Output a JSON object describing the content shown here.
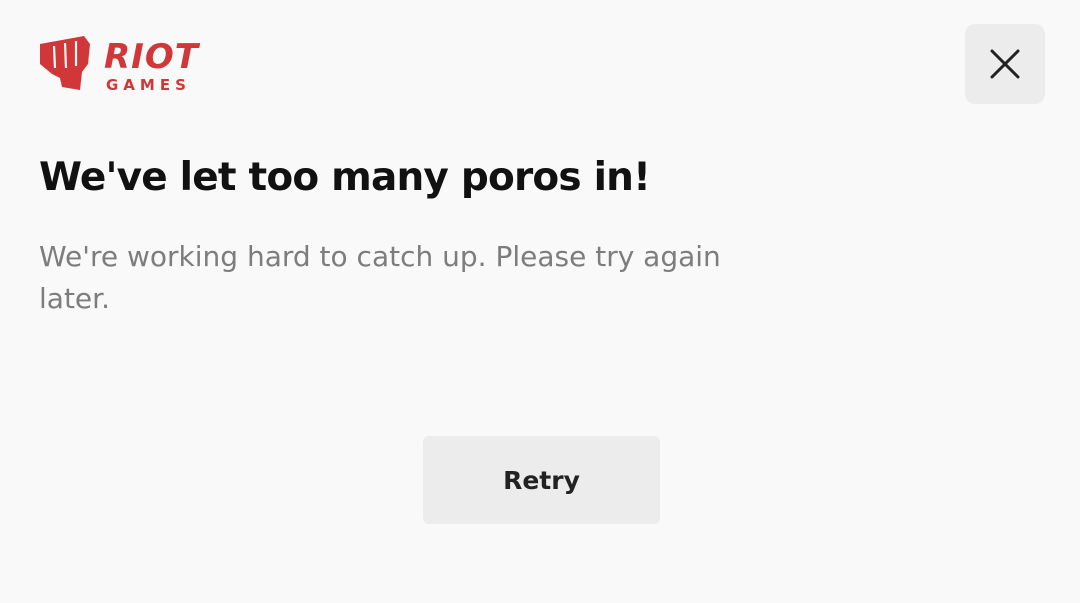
{
  "logo": {
    "brand": "RIOT GAMES",
    "icon": "riot-fist-icon",
    "color": "#d13639"
  },
  "close_button": {
    "icon": "close-icon"
  },
  "error": {
    "title": "We've let too many poros in!",
    "message": "We're working hard to catch up. Please try again later."
  },
  "retry_button": {
    "label": "Retry"
  }
}
